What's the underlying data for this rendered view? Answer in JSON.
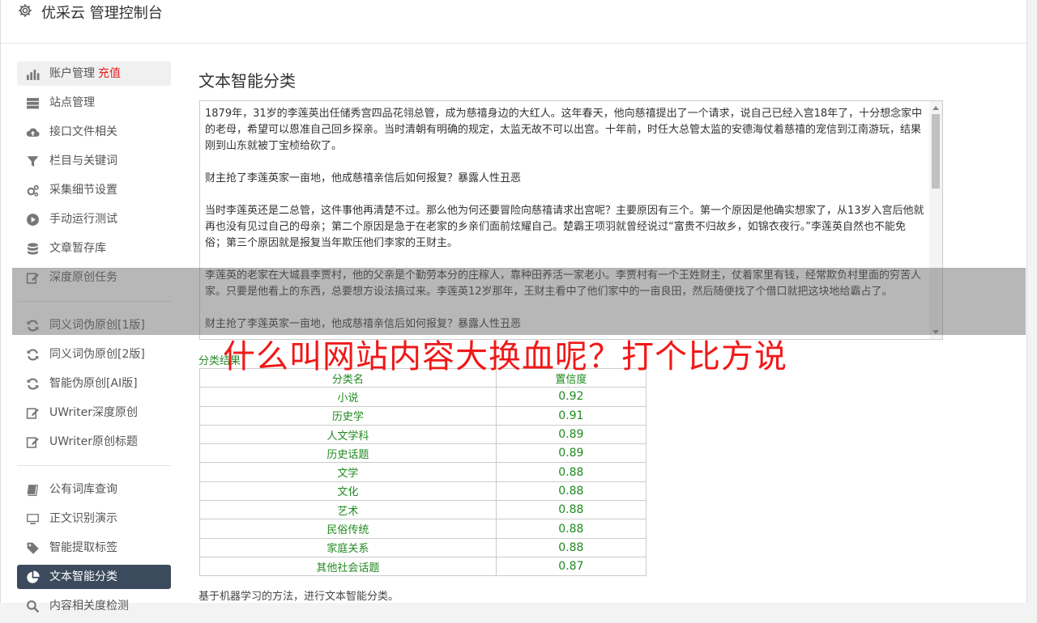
{
  "header": {
    "title": "优采云 管理控制台",
    "icon": "gear-icon"
  },
  "sidebar": {
    "groups": [
      [
        {
          "label": "账户管理",
          "badge": "充值",
          "icon": "bar-chart-icon"
        },
        {
          "label": "站点管理",
          "icon": "server-icon"
        },
        {
          "label": "接口文件相关",
          "icon": "cloud-upload-icon"
        },
        {
          "label": "栏目与关键词",
          "icon": "filter-icon"
        },
        {
          "label": "采集细节设置",
          "icon": "gears-icon"
        },
        {
          "label": "手动运行测试",
          "icon": "play-circle-icon"
        },
        {
          "label": "文章暂存库",
          "icon": "database-icon"
        },
        {
          "label": "深度原创任务",
          "icon": "edit-icon"
        }
      ],
      [
        {
          "label": "同义词伪原创[1版]",
          "icon": "refresh-icon"
        },
        {
          "label": "同义词伪原创[2版]",
          "icon": "refresh-icon"
        },
        {
          "label": "智能伪原创[AI版]",
          "icon": "refresh-icon"
        },
        {
          "label": "UWriter深度原创",
          "icon": "edit-icon"
        },
        {
          "label": "UWriter原创标题",
          "icon": "edit-icon"
        }
      ],
      [
        {
          "label": "公有词库查询",
          "icon": "book-icon"
        },
        {
          "label": "正文识别演示",
          "icon": "monitor-icon"
        },
        {
          "label": "智能提取标签",
          "icon": "tag-icon"
        },
        {
          "label": "文本智能分类",
          "icon": "pie-chart-icon",
          "active": true
        },
        {
          "label": "内容相关度检测",
          "icon": "search-icon"
        }
      ]
    ]
  },
  "main": {
    "title": "文本智能分类",
    "input_text": [
      "1879年，31岁的李莲英出任储秀宫四品花翎总管，成为慈禧身边的大红人。这年春天，他向慈禧提出了一个请求，说自己已经入宫18年了，十分想念家中的老母，希望可以恩准自己回乡探亲。当时清朝有明确的规定，太监无故不可以出宫。十年前，时任大总管太监的安德海仗着慈禧的宠信到江南游玩，结果刚到山东就被丁宝桢给砍了。",
      "财主抢了李莲英家一亩地，他成慈禧亲信后如何报复？暴露人性丑恶",
      "当时李莲英还是二总管，这件事他再清楚不过。那么他为何还要冒险向慈禧请求出宫呢？主要原因有三个。第一个原因是他确实想家了，从13岁入宫后他就再也没有见过自己的母亲；第二个原因是急于在老家的乡亲们面前炫耀自己。楚霸王项羽就曾经说过“富贵不归故乡，如锦衣夜行。”李莲英自然也不能免俗；第三个原因就是报复当年欺压他们李家的王财主。",
      "李莲英的老家在大城县李贾村，他的父亲是个勤劳本分的庄稼人，靠种田养活一家老小。李贾村有一个王姓财主，仗着家里有钱，经常欺负村里面的穷苦人家。只要是他看上的东西，总要想方设法搞过来。李莲英12岁那年，王财主看中了他们家中的一亩良田，然后随便找了个借口就把这块地给霸占了。",
      "财主抢了李莲英家一亩地，他成慈禧亲信后如何报复？暴露人性丑恶"
    ],
    "overlay_caption": "什么叫网站内容大换血呢？打个比方说",
    "result_label": "分类结果：",
    "table": {
      "headers": [
        "分类名",
        "置信度"
      ],
      "rows": [
        [
          "小说",
          "0.92"
        ],
        [
          "历史学",
          "0.91"
        ],
        [
          "人文学科",
          "0.89"
        ],
        [
          "历史话题",
          "0.89"
        ],
        [
          "文学",
          "0.88"
        ],
        [
          "文化",
          "0.88"
        ],
        [
          "艺术",
          "0.88"
        ],
        [
          "民俗传统",
          "0.88"
        ],
        [
          "家庭关系",
          "0.88"
        ],
        [
          "其他社会话题",
          "0.87"
        ]
      ]
    },
    "footnote": "基于机器学习的方法，进行文本智能分类。"
  },
  "colors": {
    "active_nav": "#3b4a5c",
    "badge": "#e02020",
    "result_text": "#1f8a1f",
    "caption": "#f01818"
  }
}
